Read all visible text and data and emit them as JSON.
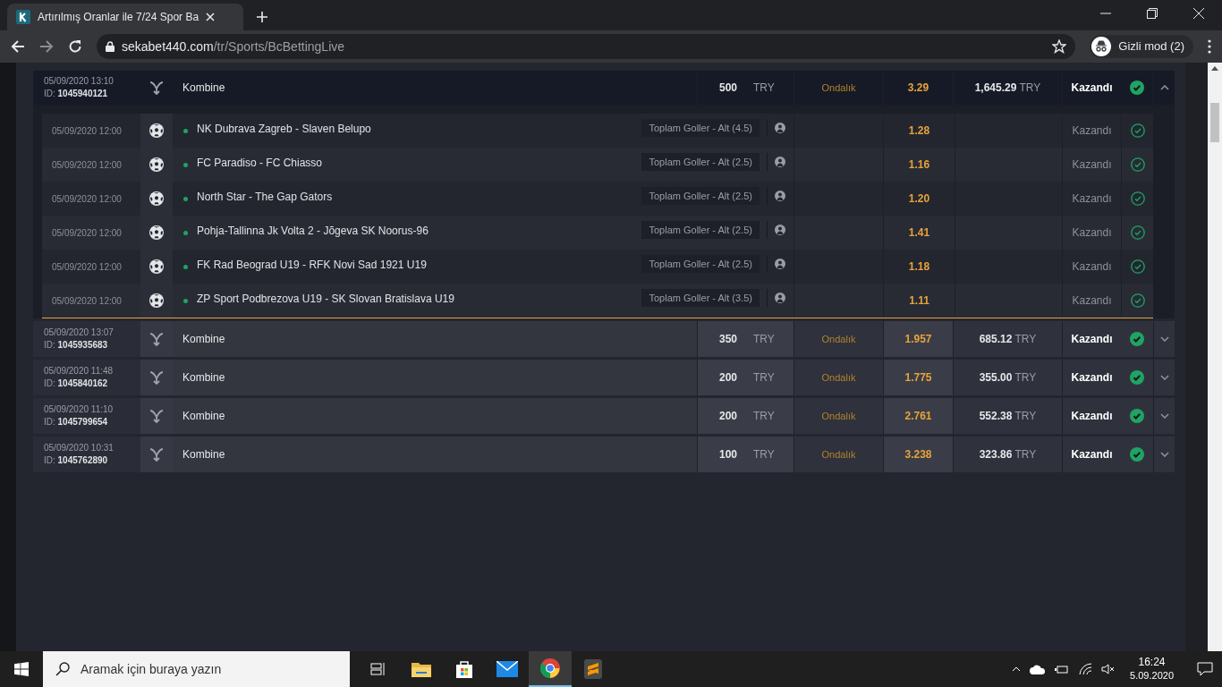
{
  "browser": {
    "tab_title": "Artırılmış Oranlar ile 7/24 Spor Ba",
    "url_host": "sekabet440.com",
    "url_path": "/tr/Sports/BcBettingLive",
    "profile": "Gizli mod (2)"
  },
  "bets": [
    {
      "date": "05/09/2020 13:10",
      "id_label": "ID:",
      "id": "1045940121",
      "type": "Kombine",
      "stake": "500",
      "currency": "TRY",
      "odds_format": "Ondalık",
      "odds": "3.29",
      "payout": "1,645.29",
      "payout_currency": "TRY",
      "status": "Kazandı",
      "expanded": true,
      "selections": [
        {
          "date": "05/09/2020 12:00",
          "event": "NK Dubrava Zagreb - Slaven Belupo",
          "market": "Toplam Goller - Alt (4.5)",
          "odds": "1.28",
          "status": "Kazandı"
        },
        {
          "date": "05/09/2020 12:00",
          "event": "FC Paradiso - FC Chiasso",
          "market": "Toplam Goller - Alt (2.5)",
          "odds": "1.16",
          "status": "Kazandı"
        },
        {
          "date": "05/09/2020 12:00",
          "event": "North Star - The Gap Gators",
          "market": "Toplam Goller - Alt (2.5)",
          "odds": "1.20",
          "status": "Kazandı"
        },
        {
          "date": "05/09/2020 12:00",
          "event": "Pohja-Tallinna Jk Volta 2 - Jõgeva SK Noorus-96",
          "market": "Toplam Goller - Alt (2.5)",
          "odds": "1.41",
          "status": "Kazandı"
        },
        {
          "date": "05/09/2020 12:00",
          "event": "FK Rad Beograd U19 - RFK Novi Sad 1921 U19",
          "market": "Toplam Goller - Alt (2.5)",
          "odds": "1.18",
          "status": "Kazandı"
        },
        {
          "date": "05/09/2020 12:00",
          "event": "ZP Sport Podbrezova U19 - SK Slovan Bratislava U19",
          "market": "Toplam Goller - Alt (3.5)",
          "odds": "1.11",
          "status": "Kazandı"
        }
      ]
    },
    {
      "date": "05/09/2020 13:07",
      "id_label": "ID:",
      "id": "1045935683",
      "type": "Kombine",
      "stake": "350",
      "currency": "TRY",
      "odds_format": "Ondalık",
      "odds": "1.957",
      "payout": "685.12",
      "payout_currency": "TRY",
      "status": "Kazandı",
      "expanded": false
    },
    {
      "date": "05/09/2020 11:48",
      "id_label": "ID:",
      "id": "1045840162",
      "type": "Kombine",
      "stake": "200",
      "currency": "TRY",
      "odds_format": "Ondalık",
      "odds": "1.775",
      "payout": "355.00",
      "payout_currency": "TRY",
      "status": "Kazandı",
      "expanded": false
    },
    {
      "date": "05/09/2020 11:10",
      "id_label": "ID:",
      "id": "1045799654",
      "type": "Kombine",
      "stake": "200",
      "currency": "TRY",
      "odds_format": "Ondalık",
      "odds": "2.761",
      "payout": "552.38",
      "payout_currency": "TRY",
      "status": "Kazandı",
      "expanded": false
    },
    {
      "date": "05/09/2020 10:31",
      "id_label": "ID:",
      "id": "1045762890",
      "type": "Kombine",
      "stake": "100",
      "currency": "TRY",
      "odds_format": "Ondalık",
      "odds": "3.238",
      "payout": "323.86",
      "payout_currency": "TRY",
      "status": "Kazandı",
      "expanded": false
    }
  ],
  "taskbar": {
    "search_placeholder": "Aramak için buraya yazın",
    "apps": [
      {
        "kind": "taskview",
        "selected": false
      },
      {
        "kind": "explorer",
        "selected": false
      },
      {
        "kind": "store",
        "selected": false
      },
      {
        "kind": "mail",
        "selected": false
      },
      {
        "kind": "chrome",
        "selected": true
      },
      {
        "kind": "sublime",
        "selected": false
      }
    ],
    "time": "16:24",
    "date": "5.09.2020"
  }
}
